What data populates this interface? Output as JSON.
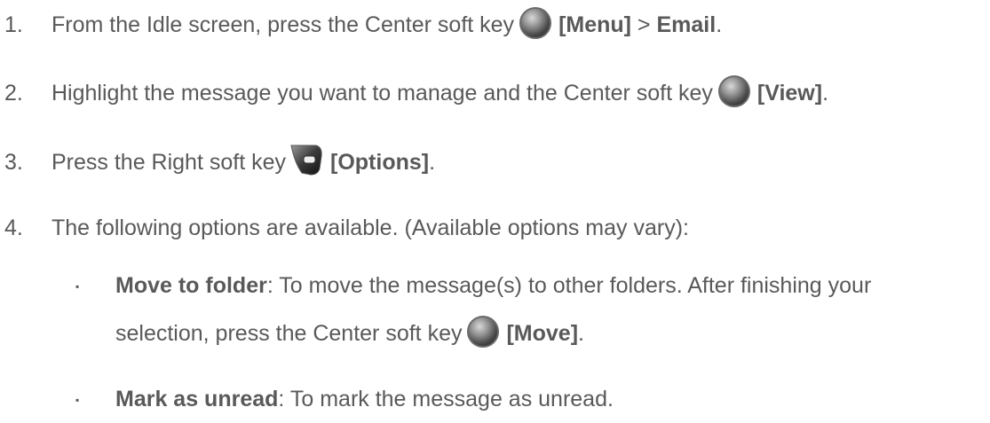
{
  "steps": [
    {
      "num": "1.",
      "pre": "From the Idle screen, press the Center soft key",
      "key": "center-soft-key-icon",
      "bold1": "[Menu]",
      "mid": " > ",
      "bold2": "Email",
      "post": "."
    },
    {
      "num": "2.",
      "pre": "Highlight the message you want to manage and the Center soft key",
      "key": "center-soft-key-icon",
      "bold1": "[View]",
      "post": "."
    },
    {
      "num": "3.",
      "pre": "Press the Right soft key",
      "key": "right-soft-key-icon",
      "bold1": "[Options]",
      "post": "."
    },
    {
      "num": "4.",
      "pre": "The following options are available. (Available options may vary):"
    }
  ],
  "options": [
    {
      "bullet": "▪",
      "title": "Move to folder",
      "desc": ": To move the message(s) to other folders. After finishing your",
      "desc2_pre": "selection, press the Center soft key",
      "key": "center-soft-key-icon",
      "bold": "[Move]",
      "post": "."
    },
    {
      "bullet": "▪",
      "title": "Mark as unread",
      "desc": ": To mark the message as unread."
    }
  ]
}
